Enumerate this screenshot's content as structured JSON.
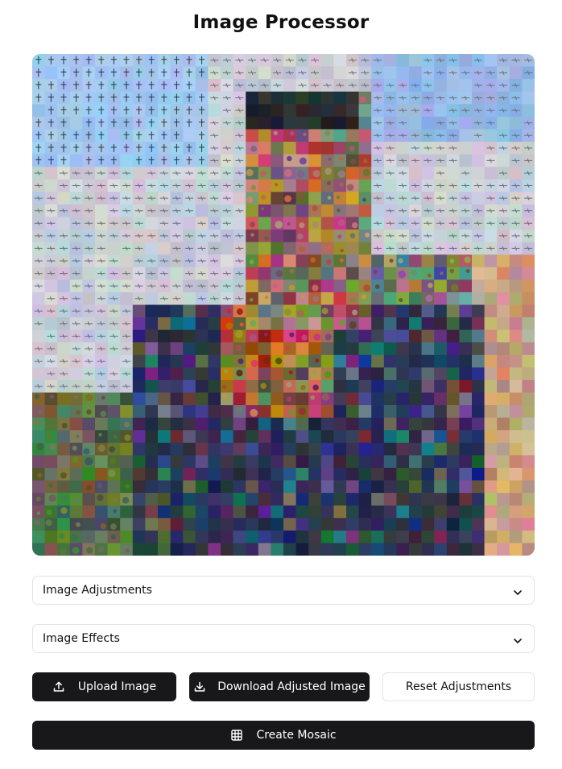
{
  "page": {
    "title": "Image Processor"
  },
  "mosaic": {
    "description_icon": "image-mosaic"
  },
  "accordions": [
    {
      "label": "Image Adjustments",
      "icon": "chevron-down-icon"
    },
    {
      "label": "Image Effects",
      "icon": "chevron-down-icon"
    }
  ],
  "actions": {
    "upload_label": "Upload Image",
    "upload_icon": "upload-icon",
    "download_label": "Download Adjusted Image",
    "download_icon": "download-icon",
    "reset_label": "Reset Adjustments",
    "mosaic_label": "Create Mosaic",
    "mosaic_icon": "grid-icon"
  },
  "colors": {
    "primary_button": "#18181b",
    "border": "#e3e3e6",
    "background": "#ffffff"
  }
}
